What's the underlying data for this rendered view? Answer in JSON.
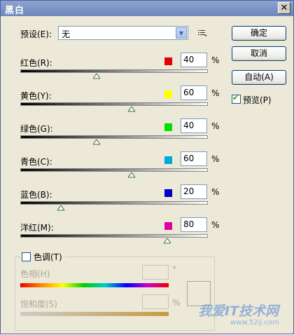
{
  "window": {
    "title": "黑白",
    "close_label": "✕"
  },
  "preset": {
    "label": "预设(E):",
    "value": "无"
  },
  "buttons": {
    "ok": "确定",
    "cancel": "取消",
    "auto": "自动(A)"
  },
  "preview": {
    "label": "预览(P)",
    "checked": true
  },
  "sliders": [
    {
      "label": "红色(R):",
      "value": "40",
      "unit": "%",
      "color": "#e00000",
      "fraction": 0.4
    },
    {
      "label": "黄色(Y):",
      "value": "60",
      "unit": "%",
      "color": "#ffff00",
      "fraction": 0.6
    },
    {
      "label": "绿色(G):",
      "value": "40",
      "unit": "%",
      "color": "#00e000",
      "fraction": 0.4
    },
    {
      "label": "青色(C):",
      "value": "60",
      "unit": "%",
      "color": "#00a8e0",
      "fraction": 0.6
    },
    {
      "label": "蓝色(B):",
      "value": "20",
      "unit": "%",
      "color": "#0000c8",
      "fraction": 0.2
    },
    {
      "label": "洋红(M):",
      "value": "80",
      "unit": "%",
      "color": "#e000a0",
      "fraction": 0.8
    }
  ],
  "tint": {
    "label": "色调(T)",
    "hue_label": "色相(H)",
    "hue_unit": "°",
    "saturation_label": "饱和度(S)",
    "saturation_unit": "%"
  },
  "watermark": {
    "text": "我爱IT技术网",
    "url": "www.52ij.com"
  }
}
